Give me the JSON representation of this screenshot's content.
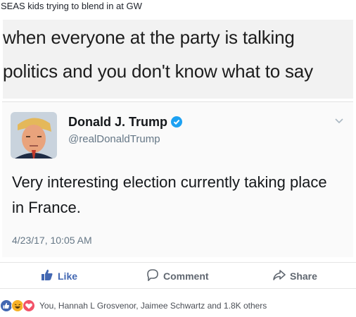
{
  "post": {
    "text": "SEAS kids trying to blend in at GW"
  },
  "meme": {
    "caption_line1": "when everyone at the party is talking",
    "caption_line2": "politics and you don't know what to say",
    "tweet": {
      "name": "Donald J. Trump",
      "handle": "@realDonaldTrump",
      "body": "Very interesting election currently taking place in France.",
      "timestamp": "4/23/17, 10:05 AM"
    }
  },
  "actions": {
    "like_label": "Like",
    "comment_label": "Comment",
    "share_label": "Share"
  },
  "reactions": {
    "summary": "You, Hannah L Grosvenor, Jaimee Schwartz and 1.8K others",
    "icons": [
      "like-reaction-icon",
      "haha-reaction-icon",
      "love-reaction-icon"
    ]
  },
  "colors": {
    "like_blue": "#4267b2",
    "verified_blue": "#1da1f2",
    "love_red": "#f25268",
    "haha_yellow": "#f7b125"
  }
}
